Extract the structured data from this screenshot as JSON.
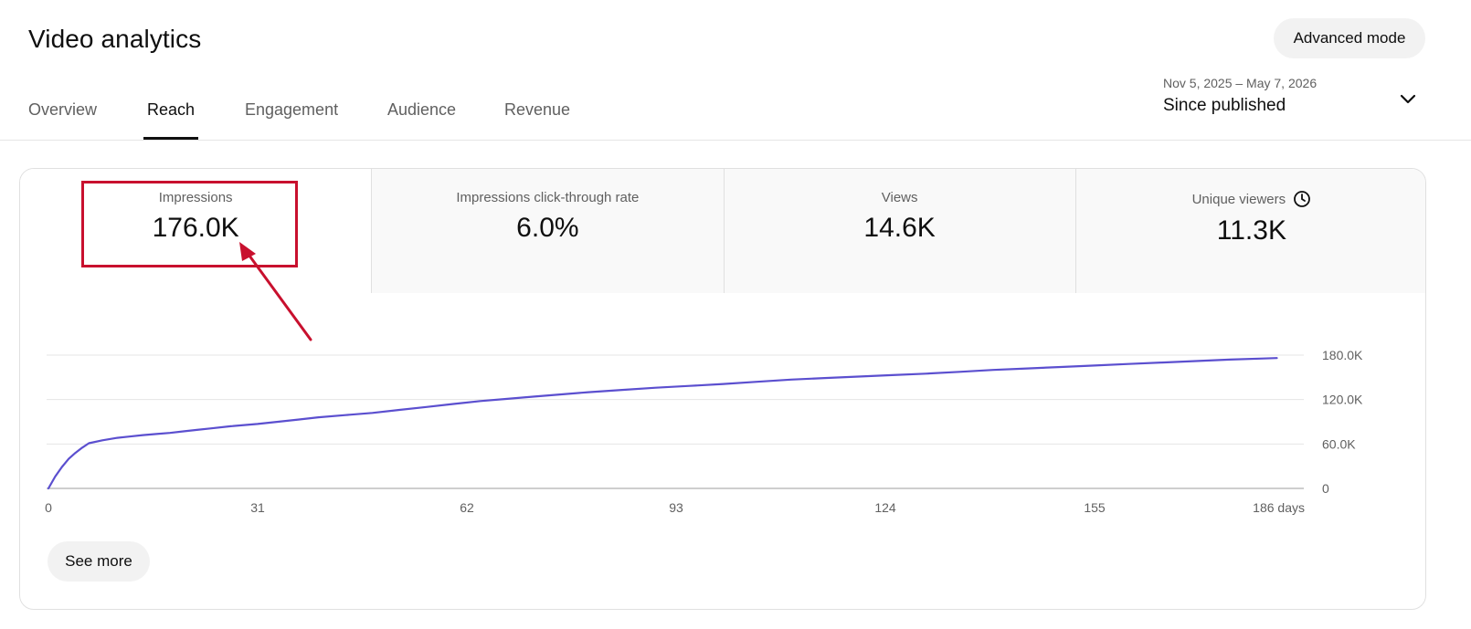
{
  "header": {
    "title": "Video analytics",
    "advanced_mode_label": "Advanced mode"
  },
  "tabs": [
    {
      "label": "Overview",
      "active": false
    },
    {
      "label": "Reach",
      "active": true
    },
    {
      "label": "Engagement",
      "active": false
    },
    {
      "label": "Audience",
      "active": false
    },
    {
      "label": "Revenue",
      "active": false
    }
  ],
  "date_picker": {
    "range": "Nov 5, 2025 – May 7, 2026",
    "label": "Since published",
    "icon": "chevron-down-icon"
  },
  "metrics": [
    {
      "label": "Impressions",
      "value": "176.0K",
      "selected": true
    },
    {
      "label": "Impressions click-through rate",
      "value": "6.0%",
      "selected": false
    },
    {
      "label": "Views",
      "value": "14.6K",
      "selected": false
    },
    {
      "label": "Unique viewers",
      "value": "11.3K",
      "selected": false,
      "icon": "clock-icon"
    }
  ],
  "see_more_label": "See more",
  "annotation": {
    "color": "#c8102e",
    "target": "Impressions"
  },
  "colors": {
    "line": "#5b4fcf",
    "annotation": "#c8102e"
  },
  "chart_data": {
    "type": "line",
    "title": "",
    "xlabel": "",
    "ylabel": "",
    "x_ticks": [
      "0",
      "31",
      "62",
      "93",
      "124",
      "155",
      "186 days"
    ],
    "x_tick_values": [
      0,
      31,
      62,
      93,
      124,
      155,
      186
    ],
    "y_ticks": [
      "0",
      "60.0K",
      "120.0K",
      "180.0K"
    ],
    "y_tick_values": [
      0,
      60000,
      120000,
      180000
    ],
    "xlim": [
      0,
      186
    ],
    "ylim": [
      0,
      180000
    ],
    "grid": true,
    "series": [
      {
        "values_x": [
          0,
          1,
          2,
          3,
          4,
          5,
          6,
          8,
          10,
          12,
          14,
          16,
          18,
          20,
          22,
          24,
          27,
          31,
          34,
          37,
          40,
          44,
          48,
          52,
          56,
          60,
          64,
          68,
          72,
          76,
          80,
          85,
          90,
          95,
          100,
          105,
          110,
          115,
          120,
          125,
          130,
          135,
          140,
          145,
          150,
          155,
          160,
          165,
          170,
          175,
          180,
          182
        ],
        "values_y": [
          0,
          16000,
          29000,
          40000,
          48000,
          55000,
          61000,
          65000,
          68000,
          70000,
          72000,
          73500,
          75000,
          77000,
          79000,
          81000,
          84000,
          87000,
          90000,
          93000,
          96000,
          99000,
          102000,
          106000,
          110000,
          114000,
          118000,
          121000,
          124000,
          127000,
          130000,
          133000,
          136000,
          138500,
          141000,
          144000,
          147000,
          149000,
          151000,
          153000,
          155000,
          157500,
          160000,
          162000,
          164000,
          166000,
          168000,
          170000,
          172000,
          174000,
          175500,
          176000
        ]
      }
    ]
  }
}
